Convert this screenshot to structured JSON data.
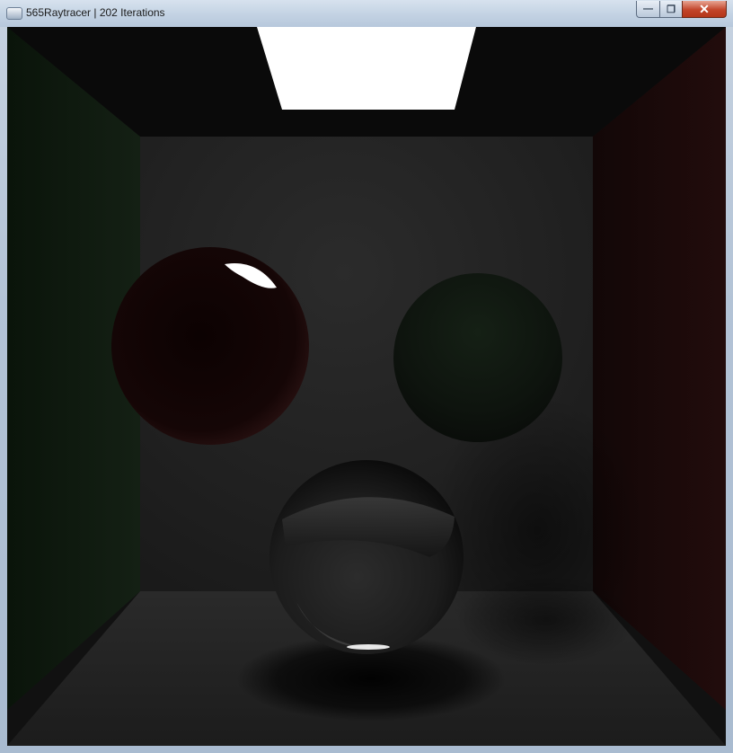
{
  "window": {
    "title": "565Raytracer | 202 Iterations"
  },
  "controls": {
    "minimize": "—",
    "maximize": "❐",
    "close": "✕"
  },
  "render": {
    "scene": "cornell-box",
    "colors": {
      "left_wall": "#0e1a0e",
      "right_wall": "#1a0909",
      "back_wall": "#262626",
      "floor": "#222222",
      "ceiling": "#0a0a0a",
      "light": "#ffffff"
    }
  }
}
